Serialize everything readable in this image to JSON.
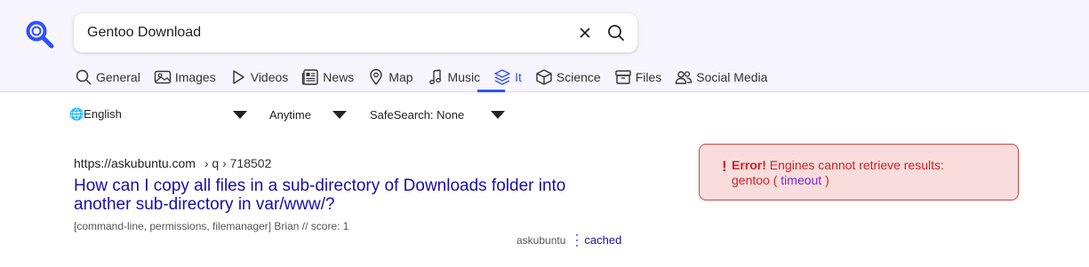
{
  "search": {
    "query": "Gentoo Download",
    "placeholder": ""
  },
  "tabs": [
    {
      "label": "General",
      "icon": "search-icon"
    },
    {
      "label": "Images",
      "icon": "image-icon"
    },
    {
      "label": "Videos",
      "icon": "play-icon"
    },
    {
      "label": "News",
      "icon": "newspaper-icon"
    },
    {
      "label": "Map",
      "icon": "map-pin-icon"
    },
    {
      "label": "Music",
      "icon": "music-note-icon"
    },
    {
      "label": "It",
      "icon": "layers-icon",
      "active": true
    },
    {
      "label": "Science",
      "icon": "cube-icon"
    },
    {
      "label": "Files",
      "icon": "archive-icon"
    },
    {
      "label": "Social Media",
      "icon": "people-icon"
    }
  ],
  "filters": {
    "language": "🌐English",
    "time": "Anytime",
    "safesearch": "SafeSearch: None"
  },
  "result": {
    "url": "https://askubuntu.com",
    "breadcrumbs": "› q › 718502",
    "title": "How can I copy all files in a sub-directory of Downloads folder into another sub-directory in var/www/?",
    "snippet": "[command-line, permissions, filemanager] Brian // score: 1",
    "engine": "askubuntu",
    "cached_label": "cached"
  },
  "error": {
    "mark": "!",
    "heading": "Error!",
    "message": "Engines cannot retrieve results:",
    "engine": "gentoo",
    "open_paren": "(",
    "reason": "timeout",
    "close_paren": ")"
  },
  "colors": {
    "accent": "#3050ff",
    "link": "#1a0dab",
    "error": "#d42222",
    "error_bg": "#f9dddd"
  }
}
